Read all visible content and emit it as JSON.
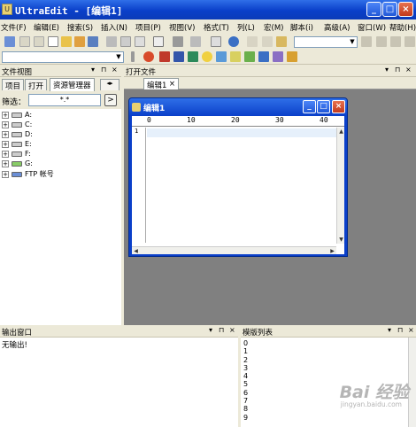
{
  "window": {
    "title": "UltraEdit - [编辑1]",
    "app_icon": "ultraedit-icon"
  },
  "menu": {
    "items": [
      "文件(F)",
      "编辑(E)",
      "搜索(S)",
      "插入(N)",
      "项目(P)",
      "视图(V)",
      "格式(T)",
      "列(L)",
      "宏(M)",
      "脚本(i)",
      "高级(A)",
      "窗口(W)",
      "帮助(H)"
    ]
  },
  "left_pane": {
    "title": "文件视图",
    "tabs": [
      "项目",
      "打开",
      "资源管理器"
    ],
    "active_tab": "资源管理器",
    "filter_label": "筛选：",
    "filter_value": "*.*",
    "tree": [
      {
        "label": "A:"
      },
      {
        "label": "C:"
      },
      {
        "label": "D:"
      },
      {
        "label": "E:"
      },
      {
        "label": "F:"
      },
      {
        "label": "G:"
      },
      {
        "label": "FTP 帐号"
      }
    ]
  },
  "editor_area": {
    "title": "打开文件",
    "doc_tab": "编辑1",
    "doc_tab_close": "×"
  },
  "child_window": {
    "title": "编辑1",
    "ruler_marks": [
      "0",
      "10",
      "20",
      "30",
      "40"
    ],
    "line_numbers": [
      "1"
    ]
  },
  "output_pane": {
    "title": "输出窗口",
    "text": "无输出!"
  },
  "template_pane": {
    "title": "模版列表",
    "items": [
      "0",
      "1",
      "2",
      "3",
      "4",
      "5",
      "6",
      "7",
      "8",
      "9"
    ]
  },
  "pane_controls": {
    "pin": "▾ ⊓ ×"
  },
  "watermark": {
    "brand": "Bai 经验",
    "url": "jingyan.baidu.com"
  },
  "colors": {
    "titlebar": "#0a3fc9",
    "chrome": "#ece9d8",
    "mdi_background": "#808080"
  }
}
